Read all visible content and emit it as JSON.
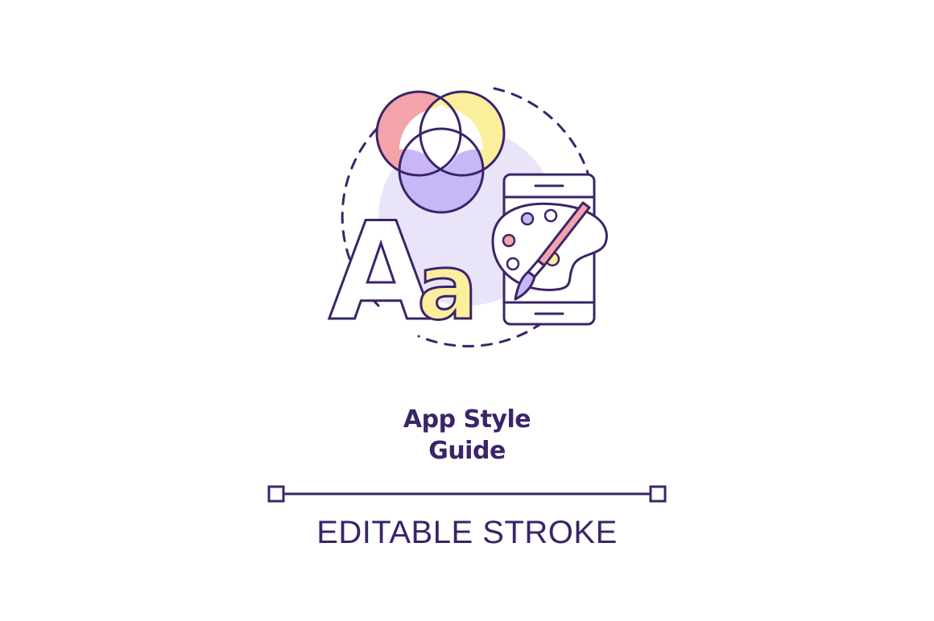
{
  "title_line_1": "App Style",
  "title_line_2": "Guide",
  "caption": "EDITABLE STROKE",
  "illustration_letters": {
    "upper": "A",
    "lower": "a"
  },
  "icons": [
    "color-venn-icon",
    "letters-icon",
    "smartphone-icon",
    "palette-icon",
    "paintbrush-icon",
    "editable-stroke-line-icon"
  ],
  "colors": {
    "stroke": "#3b2469",
    "background_blob": "#e9e4f8",
    "pink": "#f4a3aa",
    "yellow": "#fcef9c",
    "lavender": "#c8b7f7",
    "white": "#ffffff"
  }
}
